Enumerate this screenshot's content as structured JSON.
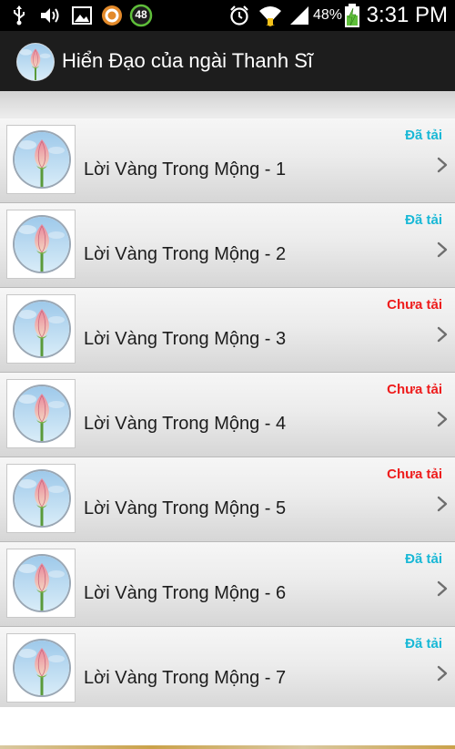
{
  "status_bar": {
    "notification_badge": "48",
    "battery_percent": "48%",
    "time": "3:31 PM",
    "icons": [
      "usb-icon",
      "volume-icon",
      "image-icon",
      "app-notification-icon",
      "badge-48-icon",
      "alarm-icon",
      "wifi-icon",
      "signal-icon",
      "battery-charging-icon"
    ]
  },
  "app_bar": {
    "title": "Hiển Đạo của ngài Thanh Sĩ",
    "icon": "lotus-icon"
  },
  "colors": {
    "status_done": "#18b8d6",
    "status_pending": "#ee1c1c",
    "app_bar_bg": "#1d1d1d"
  },
  "list": {
    "items": [
      {
        "title": "Lời Vàng Trong Mộng - 1",
        "status": "Đã tải"
      },
      {
        "title": "Lời Vàng Trong Mộng - 2",
        "status": "Đã tải"
      },
      {
        "title": "Lời Vàng Trong Mộng - 3",
        "status": "Chưa tải"
      },
      {
        "title": "Lời Vàng Trong Mộng - 4",
        "status": "Chưa tải"
      },
      {
        "title": "Lời Vàng Trong Mộng - 5",
        "status": "Chưa tải"
      },
      {
        "title": "Lời Vàng Trong Mộng - 6",
        "status": "Đã tải"
      },
      {
        "title": "Lời Vàng Trong Mộng - 7",
        "status": "Đã tải"
      }
    ]
  }
}
